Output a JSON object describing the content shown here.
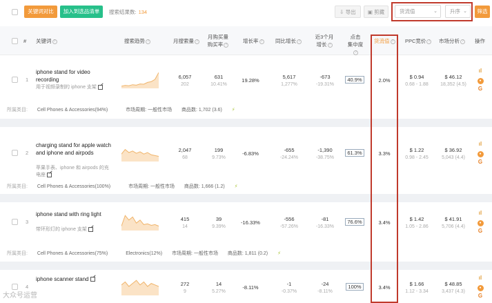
{
  "toolbar": {
    "compare_btn": "关键词对比",
    "add_btn": "加入到选品清单",
    "result_label": "搜索结果数:",
    "result_count": "134",
    "export_btn": "导出",
    "clip_btn": "剪藏",
    "sort_field": "货流值",
    "sort_order": "升序",
    "filter_btn": "筛选"
  },
  "header": {
    "index": "#",
    "keyword": "关键词",
    "trend": "搜索趋势",
    "monthly_search": "月搜索量",
    "monthly_buy_1": "月购买量",
    "monthly_buy_2": "购买率",
    "growth": "增长率",
    "yoy": "同比增长",
    "last3_1": "近3个月",
    "last3_2": "增长",
    "click_1": "点击",
    "click_2": "集中度",
    "supply": "货流值",
    "ppc": "PPC竞价",
    "market": "市场分析",
    "ops": "操作"
  },
  "rows": [
    {
      "index": "1",
      "keyword": "iphone stand for video recording",
      "keyword_zh": "用于视频录制的 iphone 支架",
      "search": "6,057",
      "search_sub": "202",
      "buy": "631",
      "buy_sub": "10.41%",
      "growth": "19.28%",
      "yoy": "5,617",
      "yoy_sub": "1,277%",
      "last3": "-673",
      "last3_sub": "-19.31%",
      "click": "40.9%",
      "supply": "2.0%",
      "ppc": "$ 0.94",
      "ppc_sub": "0.68 - 1.88",
      "market": "$ 46.12",
      "market_sub": "18,352 (4.5)",
      "category_label": "所属类目:",
      "category": "Cell Phones & Accessories(94%)",
      "period": "市场周期: 一般性市场",
      "products": "商品数: 1,702 (3.6)",
      "trend": [
        0.05,
        0.1,
        0.08,
        0.15,
        0.12,
        0.2,
        0.18,
        0.3,
        0.35,
        0.5,
        0.95
      ]
    },
    {
      "index": "2",
      "keyword": "charging stand for apple watch and iphone and airpods",
      "keyword_zh": "苹果手表、iphone 和 airpods 的充电座",
      "search": "2,047",
      "search_sub": "68",
      "buy": "199",
      "buy_sub": "9.73%",
      "growth": "-6.83%",
      "yoy": "-655",
      "yoy_sub": "-24.24%",
      "last3": "-1,390",
      "last3_sub": "-38.75%",
      "click": "61.3%",
      "supply": "3.3%",
      "ppc": "$ 1.22",
      "ppc_sub": "0.98 - 2.45",
      "market": "$ 36.92",
      "market_sub": "5,043 (4.4)",
      "category_label": "所属类目:",
      "category": "Cell Phones & Accessories(100%)",
      "period": "市场周期: 一般性市场",
      "products": "商品数: 1,666 (1.2)",
      "trend": [
        0.4,
        0.7,
        0.5,
        0.6,
        0.45,
        0.55,
        0.4,
        0.5,
        0.35,
        0.3,
        0.25
      ]
    },
    {
      "index": "3",
      "keyword": "iphone stand with ring light",
      "keyword_zh": "带环形灯的 iphone 支架",
      "search": "415",
      "search_sub": "14",
      "buy": "39",
      "buy_sub": "9.39%",
      "growth": "-16.33%",
      "yoy": "-556",
      "yoy_sub": "-57.26%",
      "last3": "-81",
      "last3_sub": "-16.33%",
      "click": "76.6%",
      "supply": "3.4%",
      "ppc": "$ 1.42",
      "ppc_sub": "1.05 - 2.86",
      "market": "$ 41.91",
      "market_sub": "5,706 (4.4)",
      "category_label": "所属类目:",
      "category": "Cell Phones & Accessories(75%)",
      "category2": "Electronics(12%)",
      "period": "市场周期: 一般性市场",
      "products": "商品数: 1,811 (0.2)",
      "trend": [
        0.2,
        0.9,
        0.6,
        0.8,
        0.4,
        0.6,
        0.3,
        0.35,
        0.25,
        0.3,
        0.2
      ]
    },
    {
      "index": "4",
      "keyword": "iphone scanner stand",
      "keyword_zh": "",
      "search": "272",
      "search_sub": "9",
      "buy": "14",
      "buy_sub": "5.27%",
      "growth": "-8.11%",
      "yoy": "-1",
      "yoy_sub": "-0.37%",
      "last3": "-24",
      "last3_sub": "-8.11%",
      "click": "100%",
      "supply": "3.4%",
      "ppc": "$ 1.66",
      "ppc_sub": "1.12 - 3.34",
      "market": "$ 48.85",
      "market_sub": "3,437 (4.3)",
      "trend": [
        0.6,
        0.8,
        0.5,
        0.7,
        0.9,
        0.6,
        0.8,
        0.5,
        0.7,
        0.6,
        0.5
      ]
    }
  ],
  "colors": {
    "accent_orange": "#f29a3b",
    "accent_teal": "#27c08a",
    "highlight_red": "#c0392b"
  },
  "watermark": "大众号运营"
}
